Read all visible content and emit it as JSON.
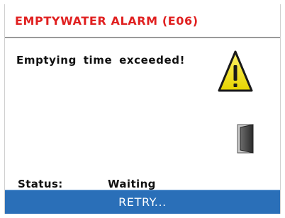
{
  "dialog": {
    "title": "EMPTYWATER ALARM (E06)",
    "message": "Emptying time exceeded!",
    "status_label": "Status:",
    "status_value": "Waiting",
    "retry_label": "RETRY..."
  },
  "icons": {
    "warning": "warning-triangle-icon",
    "door": "door-icon"
  },
  "colors": {
    "title": "#e02020",
    "warning_fill": "#f2e600",
    "button": "#2a6fb8"
  }
}
